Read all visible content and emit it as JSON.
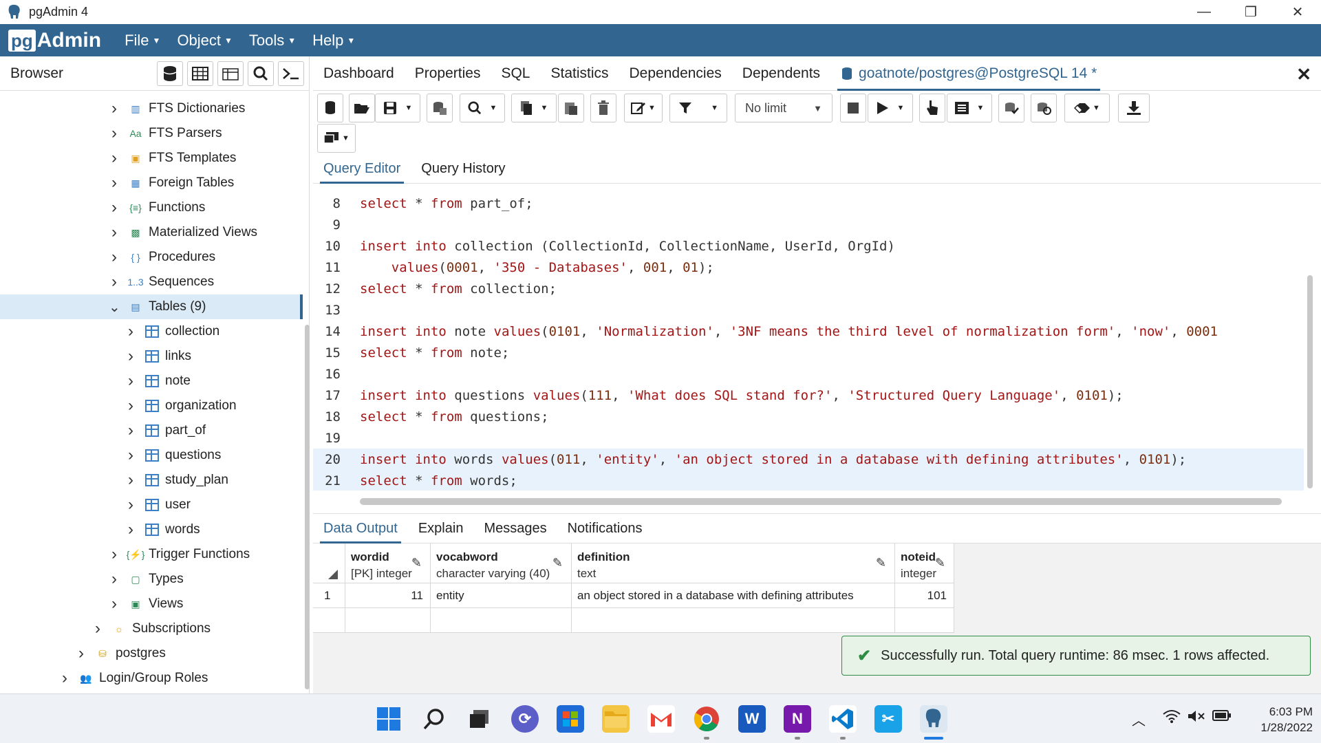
{
  "window": {
    "title": "pgAdmin 4",
    "minimize": "—",
    "restore": "❐",
    "close": "✕"
  },
  "menubar": {
    "logo_pg": "pg",
    "logo_admin": "Admin",
    "items": [
      "File",
      "Object",
      "Tools",
      "Help"
    ]
  },
  "browser": {
    "title": "Browser",
    "tree": [
      {
        "label": "FTS Dictionaries",
        "icon": "fts-dictionary-icon",
        "level": 1
      },
      {
        "label": "FTS Parsers",
        "icon": "fts-parser-icon",
        "level": 1
      },
      {
        "label": "FTS Templates",
        "icon": "fts-template-icon",
        "level": 1
      },
      {
        "label": "Foreign Tables",
        "icon": "foreign-table-icon",
        "level": 1
      },
      {
        "label": "Functions",
        "icon": "function-icon",
        "level": 1
      },
      {
        "label": "Materialized Views",
        "icon": "materialized-view-icon",
        "level": 1
      },
      {
        "label": "Procedures",
        "icon": "procedure-icon",
        "level": 1
      },
      {
        "label": "Sequences",
        "icon": "sequence-icon",
        "level": 1
      },
      {
        "label": "Tables (9)",
        "icon": "tables-icon",
        "level": 1
      },
      {
        "label": "collection",
        "icon": "table-icon",
        "level": 2
      },
      {
        "label": "links",
        "icon": "table-icon",
        "level": 2
      },
      {
        "label": "note",
        "icon": "table-icon",
        "level": 2
      },
      {
        "label": "organization",
        "icon": "table-icon",
        "level": 2
      },
      {
        "label": "part_of",
        "icon": "table-icon",
        "level": 2
      },
      {
        "label": "questions",
        "icon": "table-icon",
        "level": 2
      },
      {
        "label": "study_plan",
        "icon": "table-icon",
        "level": 2
      },
      {
        "label": "user",
        "icon": "table-icon",
        "level": 2
      },
      {
        "label": "words",
        "icon": "table-icon",
        "level": 2
      },
      {
        "label": "Trigger Functions",
        "icon": "trigger-function-icon",
        "level": 1
      },
      {
        "label": "Types",
        "icon": "type-icon",
        "level": 1
      },
      {
        "label": "Views",
        "icon": "view-icon",
        "level": 1
      },
      {
        "label": "Subscriptions",
        "icon": "subscription-icon",
        "level": 0
      },
      {
        "label": "postgres",
        "icon": "database-icon",
        "level": -1
      },
      {
        "label": "Login/Group Roles",
        "icon": "roles-icon",
        "level": -2
      }
    ]
  },
  "main_tabs": [
    "Dashboard",
    "Properties",
    "SQL",
    "Statistics",
    "Dependencies",
    "Dependents",
    "goatnote/postgres@PostgreSQL 14 *"
  ],
  "toolbar": {
    "limit": "No limit"
  },
  "query_tabs": [
    "Query Editor",
    "Query History"
  ],
  "code": [
    {
      "n": "8",
      "t": [
        [
          "kw",
          "select"
        ],
        [
          "plain",
          " * "
        ],
        [
          "kw",
          "from"
        ],
        [
          "plain",
          " part_of;"
        ]
      ]
    },
    {
      "n": "9",
      "t": []
    },
    {
      "n": "10",
      "t": [
        [
          "kw",
          "insert"
        ],
        [
          "plain",
          " "
        ],
        [
          "kw",
          "into"
        ],
        [
          "plain",
          " collection (CollectionId, CollectionName, UserId, OrgId)"
        ]
      ]
    },
    {
      "n": "11",
      "t": [
        [
          "plain",
          "    "
        ],
        [
          "kw",
          "values"
        ],
        [
          "plain",
          "("
        ],
        [
          "num",
          "0001"
        ],
        [
          "plain",
          ", "
        ],
        [
          "str",
          "'350 - Databases'"
        ],
        [
          "plain",
          ", "
        ],
        [
          "num",
          "001"
        ],
        [
          "plain",
          ", "
        ],
        [
          "num",
          "01"
        ],
        [
          "plain",
          ");"
        ]
      ]
    },
    {
      "n": "12",
      "t": [
        [
          "kw",
          "select"
        ],
        [
          "plain",
          " * "
        ],
        [
          "kw",
          "from"
        ],
        [
          "plain",
          " collection;"
        ]
      ]
    },
    {
      "n": "13",
      "t": []
    },
    {
      "n": "14",
      "t": [
        [
          "kw",
          "insert"
        ],
        [
          "plain",
          " "
        ],
        [
          "kw",
          "into"
        ],
        [
          "plain",
          " note "
        ],
        [
          "kw",
          "values"
        ],
        [
          "plain",
          "("
        ],
        [
          "num",
          "0101"
        ],
        [
          "plain",
          ", "
        ],
        [
          "str",
          "'Normalization'"
        ],
        [
          "plain",
          ", "
        ],
        [
          "str",
          "'3NF means the third level of normalization form'"
        ],
        [
          "plain",
          ", "
        ],
        [
          "str",
          "'now'"
        ],
        [
          "plain",
          ", "
        ],
        [
          "num",
          "0001"
        ]
      ]
    },
    {
      "n": "15",
      "t": [
        [
          "kw",
          "select"
        ],
        [
          "plain",
          " * "
        ],
        [
          "kw",
          "from"
        ],
        [
          "plain",
          " note;"
        ]
      ]
    },
    {
      "n": "16",
      "t": []
    },
    {
      "n": "17",
      "t": [
        [
          "kw",
          "insert"
        ],
        [
          "plain",
          " "
        ],
        [
          "kw",
          "into"
        ],
        [
          "plain",
          " questions "
        ],
        [
          "kw",
          "values"
        ],
        [
          "plain",
          "("
        ],
        [
          "num",
          "111"
        ],
        [
          "plain",
          ", "
        ],
        [
          "str",
          "'What does SQL stand for?'"
        ],
        [
          "plain",
          ", "
        ],
        [
          "str",
          "'Structured Query Language'"
        ],
        [
          "plain",
          ", "
        ],
        [
          "num",
          "0101"
        ],
        [
          "plain",
          ");"
        ]
      ]
    },
    {
      "n": "18",
      "t": [
        [
          "kw",
          "select"
        ],
        [
          "plain",
          " * "
        ],
        [
          "kw",
          "from"
        ],
        [
          "plain",
          " questions;"
        ]
      ]
    },
    {
      "n": "19",
      "t": []
    },
    {
      "n": "20",
      "t": [
        [
          "kw",
          "insert"
        ],
        [
          "plain",
          " "
        ],
        [
          "kw",
          "into"
        ],
        [
          "plain",
          " words "
        ],
        [
          "kw",
          "values"
        ],
        [
          "plain",
          "("
        ],
        [
          "num",
          "011"
        ],
        [
          "plain",
          ", "
        ],
        [
          "str",
          "'entity'"
        ],
        [
          "plain",
          ", "
        ],
        [
          "str",
          "'an object stored in a database with defining attributes'"
        ],
        [
          "plain",
          ", "
        ],
        [
          "num",
          "0101"
        ],
        [
          "plain",
          ");"
        ]
      ]
    },
    {
      "n": "21",
      "t": [
        [
          "kw",
          "select"
        ],
        [
          "plain",
          " * "
        ],
        [
          "kw",
          "from"
        ],
        [
          "plain",
          " words;"
        ]
      ]
    }
  ],
  "output_tabs": [
    "Data Output",
    "Explain",
    "Messages",
    "Notifications"
  ],
  "grid": {
    "columns": [
      {
        "name": "wordid",
        "type": "[PK] integer"
      },
      {
        "name": "vocabword",
        "type": "character varying (40)"
      },
      {
        "name": "definition",
        "type": "text"
      },
      {
        "name": "noteid",
        "type": "integer"
      }
    ],
    "rows": [
      {
        "index": "1",
        "cells": [
          "11",
          "entity",
          "an object stored in a database with defining attributes",
          "101"
        ]
      }
    ]
  },
  "toast": "Successfully run. Total query runtime: 86 msec. 1 rows affected.",
  "taskbar": {
    "time": "6:03 PM",
    "date": "1/28/2022"
  },
  "colors": {
    "brand": "#326690",
    "success": "#2e8b43"
  }
}
